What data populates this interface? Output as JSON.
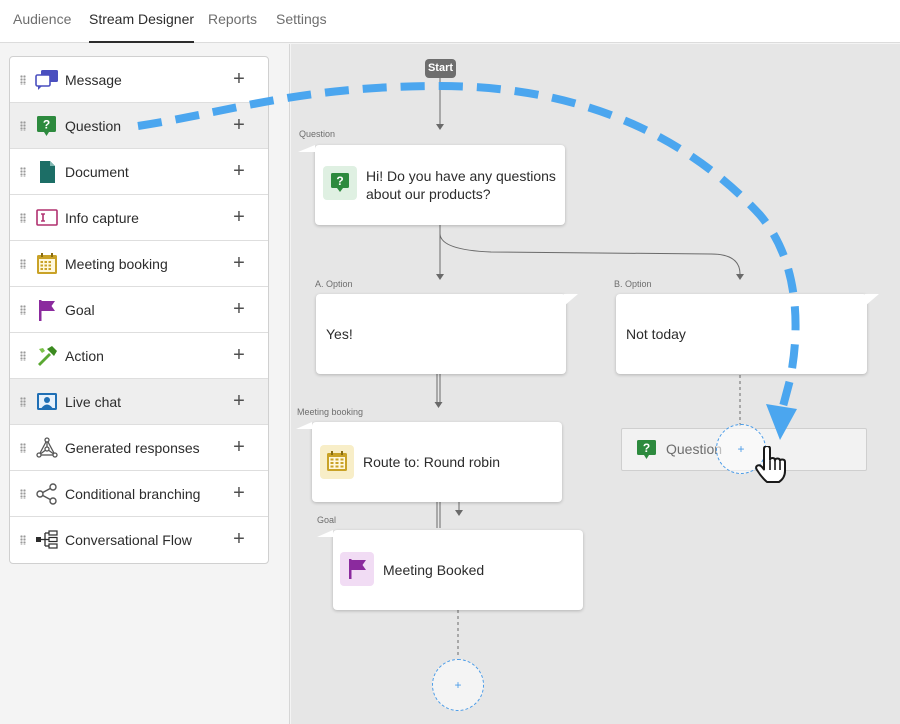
{
  "nav": {
    "tabs": [
      {
        "label": "Audience",
        "active": false
      },
      {
        "label": "Stream Designer",
        "active": true
      },
      {
        "label": "Reports",
        "active": false
      },
      {
        "label": "Settings",
        "active": false
      }
    ]
  },
  "sidebar": {
    "items": [
      {
        "label": "Message",
        "icon": "message-icon"
      },
      {
        "label": "Question",
        "icon": "question-icon"
      },
      {
        "label": "Document",
        "icon": "document-icon"
      },
      {
        "label": "Info capture",
        "icon": "info-capture-icon"
      },
      {
        "label": "Meeting booking",
        "icon": "calendar-icon"
      },
      {
        "label": "Goal",
        "icon": "flag-icon"
      },
      {
        "label": "Action",
        "icon": "hammer-icon"
      },
      {
        "label": "Live chat",
        "icon": "live-chat-icon"
      },
      {
        "label": "Generated responses",
        "icon": "network-icon"
      },
      {
        "label": "Conditional branching",
        "icon": "share-icon"
      },
      {
        "label": "Conversational Flow",
        "icon": "flow-icon"
      }
    ],
    "add_symbol": "+"
  },
  "canvas": {
    "start_label": "Start",
    "question_node": {
      "type_label": "Question",
      "text_line1": "Hi! Do you have any questions",
      "text_line2": "about our products?"
    },
    "option_a": {
      "type_label": "A. Option",
      "text": "Yes!"
    },
    "option_b": {
      "type_label": "B. Option",
      "text": "Not today"
    },
    "meeting_node": {
      "type_label": "Meeting booking",
      "text": "Route to: Round robin"
    },
    "goal_node": {
      "type_label": "Goal",
      "text": "Meeting Booked"
    },
    "ghost_item": {
      "label": "Question"
    },
    "add_symbol": "+"
  },
  "colors": {
    "accent_blue": "#4ba6ef",
    "question_green": "#2d8a3e",
    "goal_purple": "#8b2a9e",
    "calendar_gold": "#c9a227",
    "message_blue": "#4a4fbf"
  }
}
